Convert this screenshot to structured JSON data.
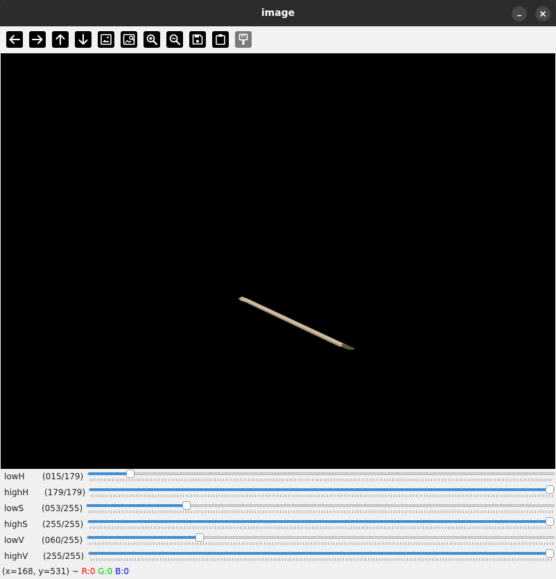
{
  "window": {
    "title": "image",
    "minimize_icon": "minimize-icon",
    "close_icon": "close-icon"
  },
  "toolbar": {
    "buttons": [
      {
        "name": "pan-left-button",
        "icon": "arrow-left-icon",
        "label": "Pan left"
      },
      {
        "name": "pan-right-button",
        "icon": "arrow-right-icon",
        "label": "Pan right"
      },
      {
        "name": "pan-up-button",
        "icon": "arrow-up-icon",
        "label": "Pan up"
      },
      {
        "name": "pan-down-button",
        "icon": "arrow-down-icon",
        "label": "Pan down"
      },
      {
        "name": "zoom-original-button",
        "icon": "image-icon",
        "label": "Zoom x1"
      },
      {
        "name": "zoom-fit-button",
        "icon": "image-search-icon",
        "label": "Zoom fit"
      },
      {
        "name": "zoom-in-button",
        "icon": "zoom-in-icon",
        "label": "Zoom in"
      },
      {
        "name": "zoom-out-button",
        "icon": "zoom-out-icon",
        "label": "Zoom out"
      },
      {
        "name": "save-button",
        "icon": "save-icon",
        "label": "Save current image"
      },
      {
        "name": "copy-clipboard-button",
        "icon": "clipboard-icon",
        "label": "Copy image to clipboard"
      },
      {
        "name": "properties-button",
        "icon": "paint-brush-icon",
        "label": "Properties",
        "disabled": true
      }
    ]
  },
  "canvas": {
    "background": "#000000",
    "object": "stick"
  },
  "trackbars": [
    {
      "name": "lowH",
      "value_text": "(015/179)",
      "value": 15,
      "max": 179
    },
    {
      "name": "highH",
      "value_text": "(179/179)",
      "value": 179,
      "max": 179
    },
    {
      "name": "lowS",
      "value_text": "(053/255)",
      "value": 53,
      "max": 255
    },
    {
      "name": "highS",
      "value_text": "(255/255)",
      "value": 255,
      "max": 255
    },
    {
      "name": "lowV",
      "value_text": "(060/255)",
      "value": 60,
      "max": 255
    },
    {
      "name": "highV",
      "value_text": "(255/255)",
      "value": 255,
      "max": 255
    }
  ],
  "status": {
    "coords": "(x=168, y=531) ~ ",
    "r": "R:0",
    "g": "G:0",
    "b": "B:0",
    "r_color": "#ff0000",
    "g_color": "#00cc00",
    "b_color": "#0000ff"
  },
  "colors": {
    "accent": "#3d8fd6",
    "titlebar": "#2c2c2c"
  }
}
